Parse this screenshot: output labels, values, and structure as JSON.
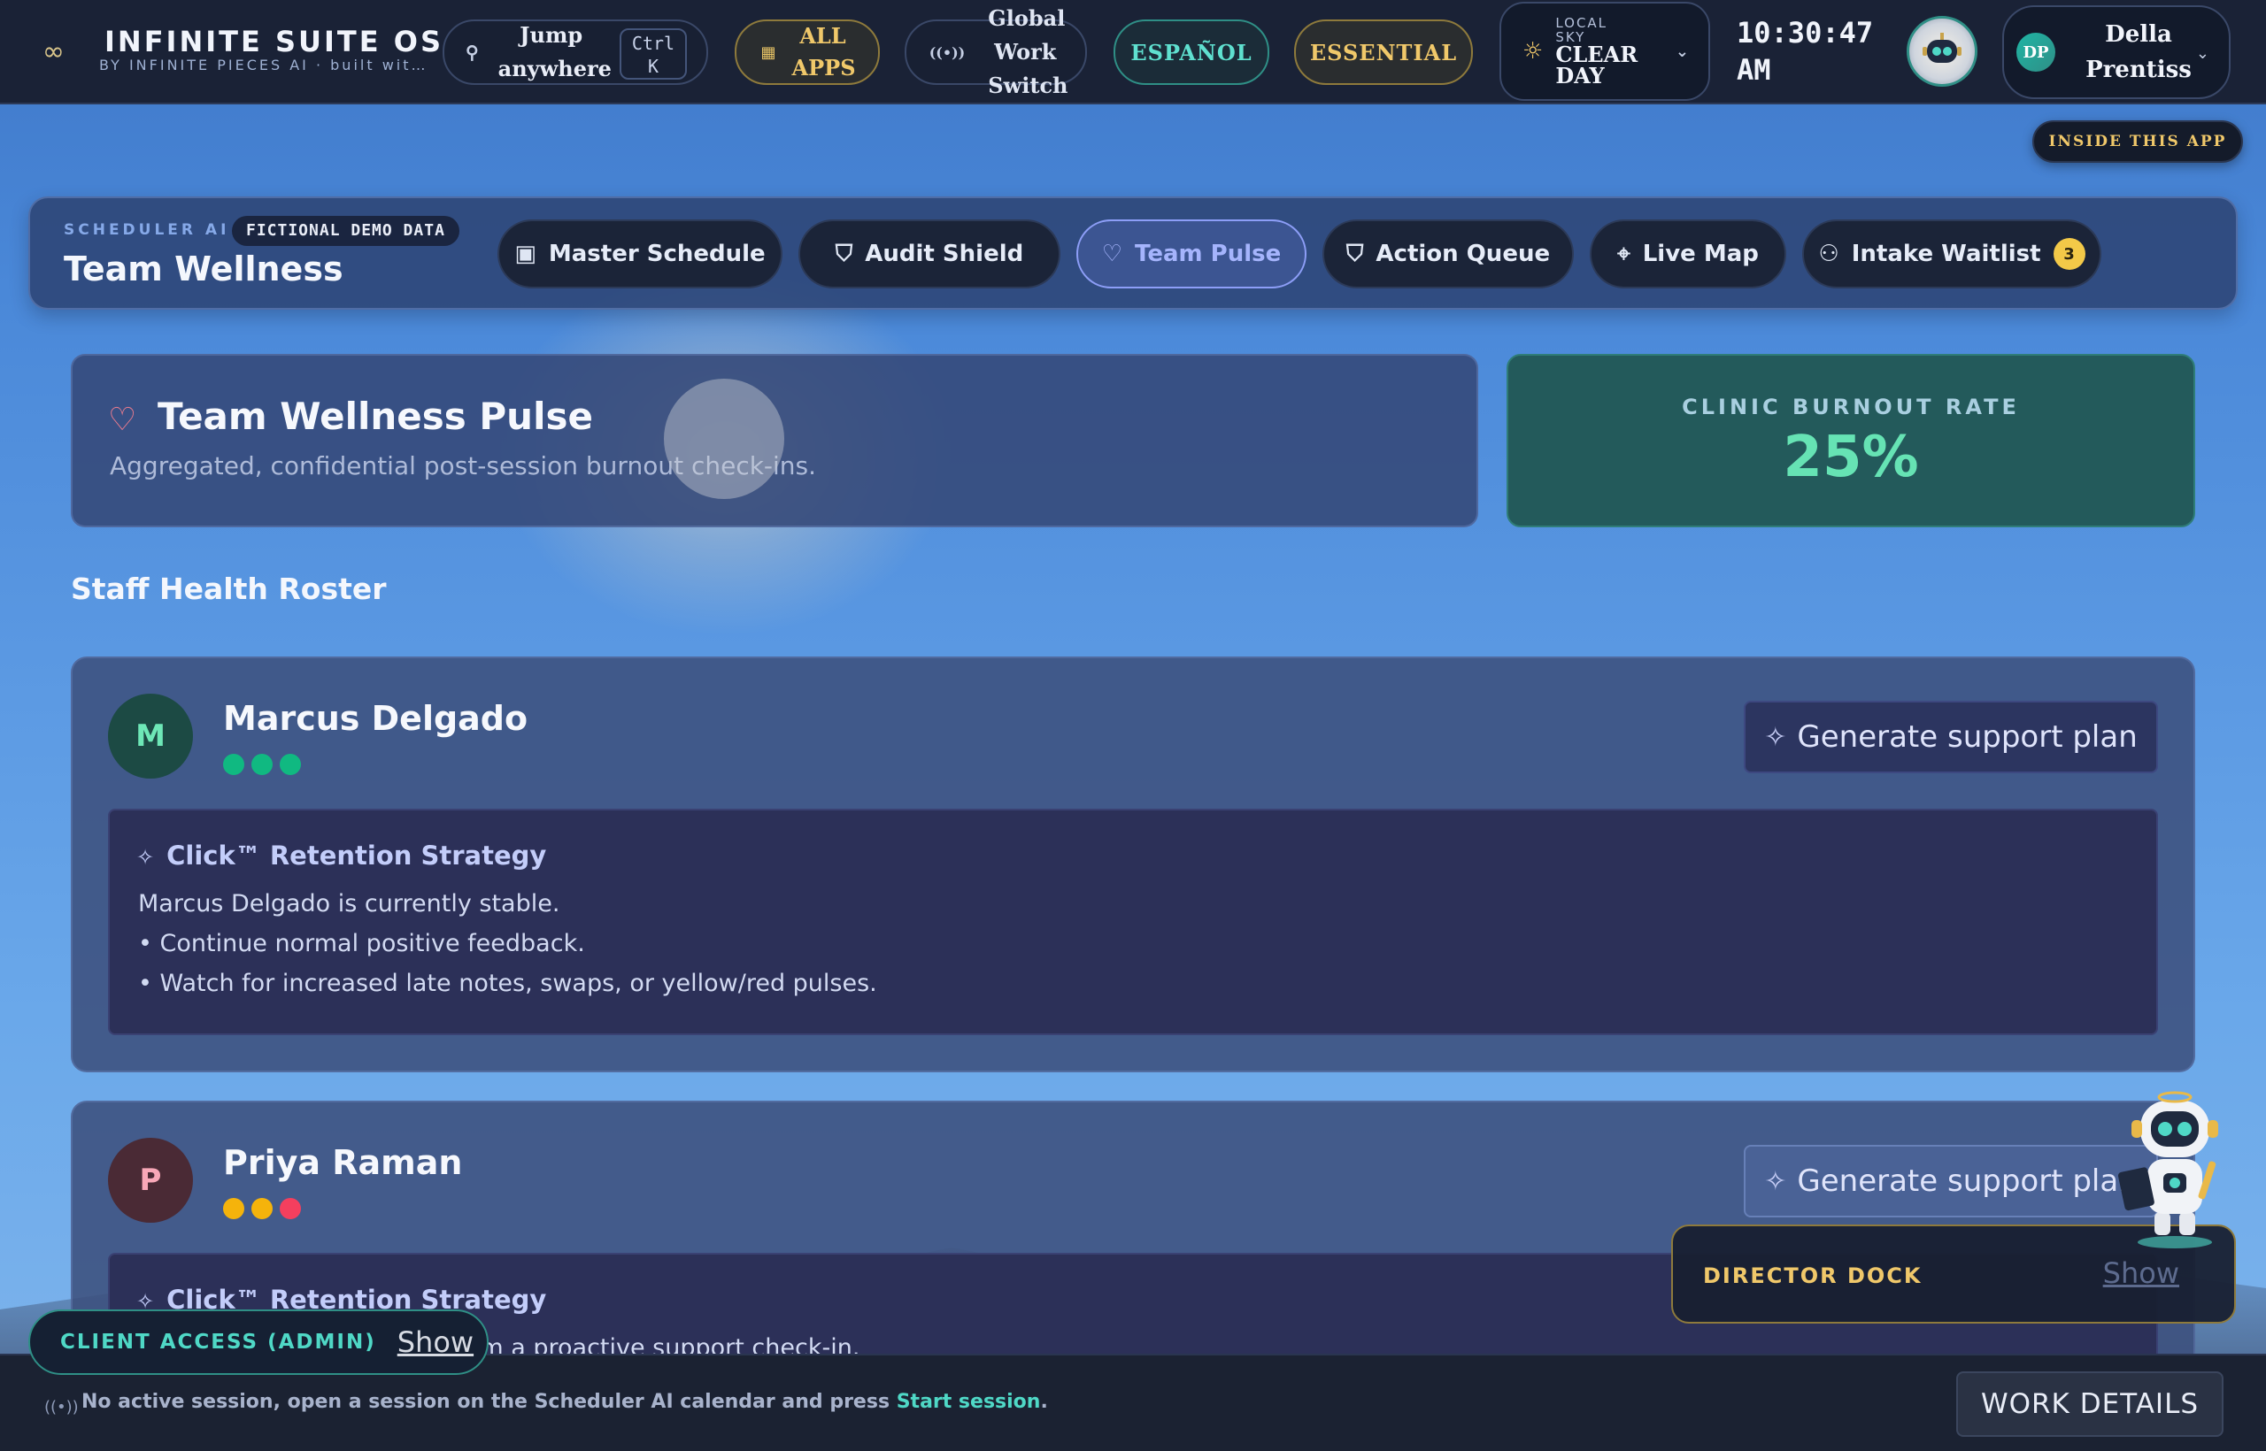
{
  "topbar": {
    "brand_title": "INFINITE SUITE OS",
    "brand_sub": "BY INFINITE PIECES AI · built with care",
    "jump_label": "Jump anywhere",
    "jump_kbd": "Ctrl K",
    "all_apps": "ALL APPS",
    "global_switch": "Global Work Switch",
    "language": "ESPAÑOL",
    "tier": "ESSENTIAL",
    "weather_label": "LOCAL SKY",
    "weather_value": "CLEAR DAY",
    "clock": "10:30:47 AM",
    "user_initials": "DP",
    "user_name": "Della Prentiss",
    "inside_app": "INSIDE THIS APP"
  },
  "scheduler": {
    "eyebrow": "SCHEDULER AI",
    "demo_badge": "FICTIONAL DEMO DATA",
    "title": "Team Wellness",
    "tabs": [
      {
        "label": "Master Schedule",
        "icon": "calendar-icon"
      },
      {
        "label": "Audit Shield",
        "icon": "shield-check-icon"
      },
      {
        "label": "Team Pulse",
        "icon": "heart-pulse-icon",
        "active": true
      },
      {
        "label": "Action Queue",
        "icon": "shield-alert-icon"
      },
      {
        "label": "Live Map",
        "icon": "map-pin-icon"
      },
      {
        "label": "Intake Waitlist",
        "icon": "user-plus-icon",
        "badge": "3"
      }
    ]
  },
  "pulse": {
    "title": "Team Wellness Pulse",
    "subtitle": "Aggregated, confidential post-session burnout check-ins.",
    "burnout_label": "CLINIC BURNOUT RATE",
    "burnout_value": "25%"
  },
  "roster": {
    "title": "Staff Health Roster",
    "generate_label": "Generate support plan",
    "staff": [
      {
        "initial": "M",
        "name": "Marcus Delgado",
        "pulses": [
          "green",
          "green",
          "green"
        ],
        "strategy_title": "Click™ Retention Strategy",
        "lines": [
          "Marcus Delgado is currently stable.",
          "• Continue normal positive feedback.",
          "• Watch for increased late notes, swaps, or yellow/red pulses."
        ]
      },
      {
        "initial": "P",
        "name": "Priya Raman",
        "pulses": [
          "yellow",
          "yellow",
          "red"
        ],
        "strategy_title": "Click™ Retention Strategy",
        "lines": [
          "Priya Raman may benefit from a proactive support check-in."
        ]
      }
    ]
  },
  "colors": {
    "green": "#10b981",
    "yellow": "#f5b30b",
    "red": "#f43f5e",
    "teal": "#4fd8c6",
    "gold": "#f0c86a"
  },
  "bottom": {
    "status_prefix": "No active session, open a session on the Scheduler AI calendar and press ",
    "status_link": "Start session",
    "status_suffix": ".",
    "work_details": "WORK DETAILS",
    "client_access": "CLIENT ACCESS (ADMIN)",
    "client_show": "Show",
    "director_dock": "DIRECTOR DOCK",
    "director_show": "Show"
  }
}
